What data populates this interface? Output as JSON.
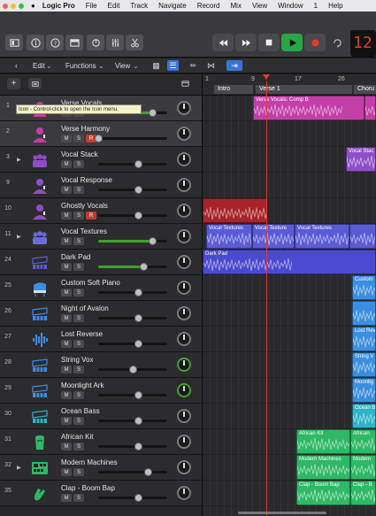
{
  "menubar": {
    "app": "Logic Pro",
    "items": [
      "File",
      "Edit",
      "Track",
      "Navigate",
      "Record",
      "Mix",
      "View",
      "Window",
      "1",
      "Help"
    ]
  },
  "transport": {
    "lcd_value": "12"
  },
  "editbar": {
    "edit": "Edit",
    "functions": "Functions",
    "view": "View"
  },
  "ruler": {
    "bars": [
      "1",
      "9",
      "17",
      "26"
    ],
    "markers": [
      "Intro",
      "Verse 1",
      "Choru"
    ]
  },
  "tooltip": "Icon - Control-click to open the Icon menu.",
  "tracks": [
    {
      "num": "1",
      "name": "Verse Vocals",
      "icon": "person-vocal-icon",
      "color": "#c23fa7",
      "rec": false,
      "fader": 0.78,
      "green": true,
      "pan_green": false,
      "disclosure": false,
      "selected": true
    },
    {
      "num": "2",
      "name": "Verse Harmony",
      "icon": "person-vocal-icon",
      "color": "#c23fa7",
      "rec": true,
      "fader": 0.0,
      "green": false,
      "pan_green": false,
      "disclosure": false,
      "selected": true
    },
    {
      "num": "3",
      "name": "Vocal Stack",
      "icon": "choir-icon",
      "color": "#8f4ec8",
      "rec": false,
      "fader": 0.58,
      "green": false,
      "pan_green": false,
      "disclosure": true,
      "selected": false
    },
    {
      "num": "9",
      "name": "Vocal Response",
      "icon": "person-vocal-icon",
      "color": "#8f4ec8",
      "rec": false,
      "fader": 0.58,
      "green": false,
      "pan_green": false,
      "disclosure": false,
      "selected": false
    },
    {
      "num": "10",
      "name": "Ghostly Vocals",
      "icon": "person-vocal-icon",
      "color": "#8f4ec8",
      "rec": true,
      "fader": 0.58,
      "green": false,
      "pan_green": false,
      "disclosure": false,
      "selected": false
    },
    {
      "num": "11",
      "name": "Vocal Textures",
      "icon": "choir-icon",
      "color": "#6a6ad8",
      "rec": false,
      "fader": 0.78,
      "green": true,
      "pan_green": false,
      "disclosure": true,
      "selected": false
    },
    {
      "num": "24",
      "name": "Dark Pad",
      "icon": "synth-icon",
      "color": "#5b5bd6",
      "rec": false,
      "fader": 0.66,
      "green": true,
      "pan_green": false,
      "disclosure": false,
      "selected": false
    },
    {
      "num": "25",
      "name": "Custom Soft Piano",
      "icon": "grand-piano-icon",
      "color": "#3c8ee0",
      "rec": false,
      "fader": 0.58,
      "green": false,
      "pan_green": false,
      "disclosure": false,
      "selected": false
    },
    {
      "num": "26",
      "name": "Night of Avalon",
      "icon": "synth-icon",
      "color": "#3c8ee0",
      "rec": false,
      "fader": 0.58,
      "green": false,
      "pan_green": false,
      "disclosure": false,
      "selected": false
    },
    {
      "num": "27",
      "name": "Lost Reverse",
      "icon": "waveform-icon",
      "color": "#3c8ee0",
      "rec": false,
      "fader": 0.58,
      "green": false,
      "pan_green": false,
      "disclosure": false,
      "selected": false
    },
    {
      "num": "28",
      "name": "String Vox",
      "icon": "synth-icon",
      "color": "#3c8ee0",
      "rec": false,
      "fader": 0.5,
      "green": false,
      "pan_green": true,
      "disclosure": false,
      "selected": false
    },
    {
      "num": "29",
      "name": "Moonlight Ark",
      "icon": "synth-icon",
      "color": "#3c8ee0",
      "rec": false,
      "fader": 0.58,
      "green": false,
      "pan_green": true,
      "disclosure": false,
      "selected": false
    },
    {
      "num": "30",
      "name": "Ocean Bass",
      "icon": "synth-icon",
      "color": "#2eb4c8",
      "rec": false,
      "fader": 0.58,
      "green": false,
      "pan_green": false,
      "disclosure": false,
      "selected": false
    },
    {
      "num": "31",
      "name": "African Kit",
      "icon": "drum-icon",
      "color": "#2fb866",
      "rec": false,
      "fader": 0.58,
      "green": false,
      "pan_green": false,
      "disclosure": false,
      "selected": false
    },
    {
      "num": "32",
      "name": "Modern Machines",
      "icon": "drum-machine-icon",
      "color": "#2fb866",
      "rec": false,
      "fader": 0.72,
      "green": false,
      "pan_green": false,
      "disclosure": true,
      "selected": false
    },
    {
      "num": "35",
      "name": "Clap - Boom Bap",
      "icon": "clap-hands-icon",
      "color": "#2fb866",
      "rec": false,
      "fader": 0.58,
      "green": false,
      "pan_green": false,
      "disclosure": false,
      "selected": false
    }
  ],
  "regions": [
    {
      "lane": 0,
      "start": 57,
      "end": 183,
      "color": "#c23fa7",
      "label": "Verse Vocals: Comp B"
    },
    {
      "lane": 0,
      "start": 183,
      "end": 196,
      "color": "#c23fa7",
      "label": ""
    },
    {
      "lane": 2,
      "start": 162,
      "end": 196,
      "color": "#8f4ec8",
      "label": "Vocal Stac"
    },
    {
      "lane": 4,
      "start": 0,
      "end": 73,
      "color": "#a8242a",
      "label": ""
    },
    {
      "lane": 5,
      "start": 4,
      "end": 56,
      "color": "#5b5bd6",
      "label": "Vocal Textures"
    },
    {
      "lane": 5,
      "start": 56,
      "end": 104,
      "color": "#5b5bd6",
      "label": "Vocal Texture"
    },
    {
      "lane": 5,
      "start": 104,
      "end": 166,
      "color": "#5b5bd6",
      "label": "Vocal Textures"
    },
    {
      "lane": 5,
      "start": 166,
      "end": 196,
      "color": "#5b5bd6",
      "label": ""
    },
    {
      "lane": 6,
      "start": 0,
      "end": 196,
      "color": "#4a4ad0",
      "label": "Dark Pad"
    },
    {
      "lane": 7,
      "start": 169,
      "end": 196,
      "color": "#3c8ee0",
      "label": "Custom"
    },
    {
      "lane": 8,
      "start": 169,
      "end": 196,
      "color": "#3c8ee0",
      "label": ""
    },
    {
      "lane": 9,
      "start": 169,
      "end": 196,
      "color": "#3c8ee0",
      "label": "Lost Rev"
    },
    {
      "lane": 10,
      "start": 169,
      "end": 196,
      "color": "#3c8ee0",
      "label": "String V"
    },
    {
      "lane": 11,
      "start": 169,
      "end": 196,
      "color": "#3c8ee0",
      "label": "Moonlig"
    },
    {
      "lane": 12,
      "start": 169,
      "end": 196,
      "color": "#2eb4c8",
      "label": "Ocean B"
    },
    {
      "lane": 13,
      "start": 106,
      "end": 167,
      "color": "#2fb866",
      "label": "African Kit"
    },
    {
      "lane": 13,
      "start": 167,
      "end": 196,
      "color": "#2fb866",
      "label": "African"
    },
    {
      "lane": 14,
      "start": 106,
      "end": 167,
      "color": "#2fb866",
      "label": "Modern Machines"
    },
    {
      "lane": 14,
      "start": 167,
      "end": 196,
      "color": "#2fb866",
      "label": "Modern"
    },
    {
      "lane": 15,
      "start": 106,
      "end": 167,
      "color": "#2fb866",
      "label": "Clap - Boom Bap"
    },
    {
      "lane": 15,
      "start": 167,
      "end": 196,
      "color": "#2fb866",
      "label": "Clap - B"
    }
  ]
}
